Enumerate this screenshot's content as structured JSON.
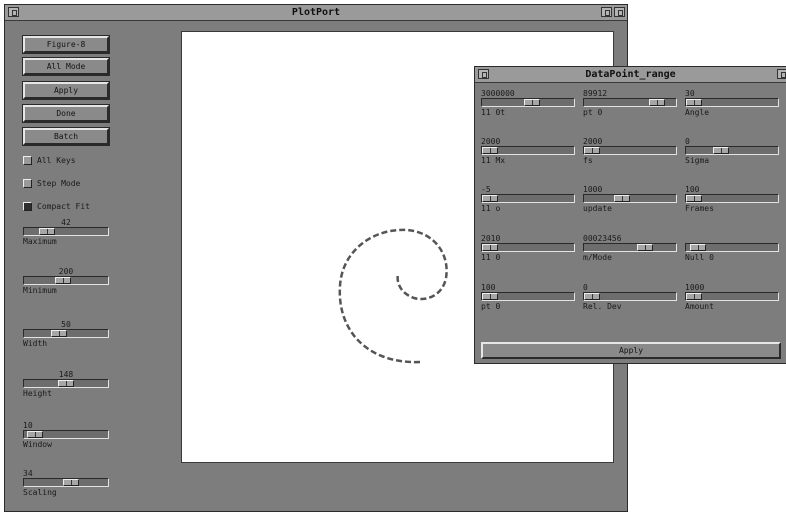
{
  "main_window": {
    "title": "PlotPort",
    "buttons": [
      "Figure-8",
      "All Mode",
      "Apply",
      "Done",
      "Batch"
    ],
    "checkboxes": [
      {
        "label": "All Keys",
        "checked": false
      },
      {
        "label": "Step Mode",
        "checked": false
      },
      {
        "label": "Compact Fit",
        "checked": true
      }
    ],
    "sliders": [
      {
        "value": "42",
        "label": "Maximum",
        "pos": 0.22
      },
      {
        "value": "200",
        "label": "Minimum",
        "pos": 0.45
      },
      {
        "value": "50",
        "label": "Width",
        "pos": 0.4
      },
      {
        "value": "148",
        "label": "Height",
        "pos": 0.5
      },
      {
        "value": "10",
        "label": "Window",
        "pos": 0.05
      },
      {
        "value": "34",
        "label": "Scaling",
        "pos": 0.58
      }
    ]
  },
  "dialog": {
    "title": "DataPoint_range",
    "fields": [
      {
        "value": "3000000",
        "label": "11 0t",
        "pos": 0.55
      },
      {
        "value": "89912",
        "label": "pt 0",
        "pos": 0.85
      },
      {
        "value": "30",
        "label": "Angle",
        "pos": 0.0
      },
      {
        "value": "2000",
        "label": "11 Mx",
        "pos": 0.0
      },
      {
        "value": "2000",
        "label": "fs",
        "pos": 0.0
      },
      {
        "value": "0",
        "label": "Sigma",
        "pos": 0.35
      },
      {
        "value": "-5",
        "label": "11 o",
        "pos": 0.0
      },
      {
        "value": "1000",
        "label": "update",
        "pos": 0.4
      },
      {
        "value": "100",
        "label": "Frames",
        "pos": 0.0
      },
      {
        "value": "2010",
        "label": "11 0",
        "pos": 0.0
      },
      {
        "value": "00023456",
        "label": "m/Mode",
        "pos": 0.7
      },
      {
        "value": "",
        "label": "Null 0",
        "pos": 0.05
      },
      {
        "value": "100",
        "label": "pt 0",
        "pos": 0.0
      },
      {
        "value": "0",
        "label": "Rel. Dev",
        "pos": 0.0
      },
      {
        "value": "1000",
        "label": "Amount",
        "pos": 0.0
      }
    ],
    "apply_label": "Apply"
  },
  "colors": {
    "panel": "#7d7d7d",
    "titlebar": "#9a9a9a",
    "canvas": "#ffffff",
    "curve": "#555555"
  }
}
